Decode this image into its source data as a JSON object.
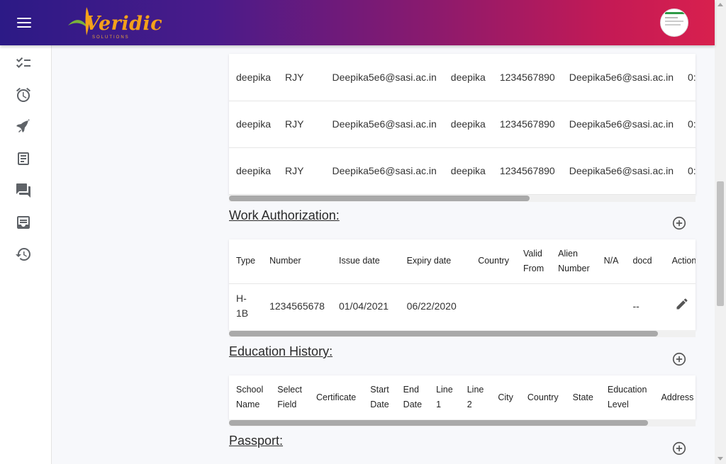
{
  "brand": {
    "logo_text": "Veridic",
    "logo_sub": "SOLUTIONS"
  },
  "colors": {
    "header_gradient_start": "#2c1a86",
    "header_gradient_end": "#d8204e",
    "logo": "#f4a11a"
  },
  "sidebar": {
    "items": [
      {
        "icon": "checklist-icon"
      },
      {
        "icon": "alarm-icon"
      },
      {
        "icon": "flight-icon"
      },
      {
        "icon": "document-icon"
      },
      {
        "icon": "chat-icon"
      },
      {
        "icon": "inbox-icon"
      },
      {
        "icon": "history-icon"
      }
    ]
  },
  "contacts_table": {
    "rows": [
      [
        "deepika",
        "RJY",
        "Deepika5e6@sasi.ac.in",
        "deepika",
        "1234567890",
        "Deepika5e6@sasi.ac.in",
        "0:"
      ],
      [
        "deepika",
        "RJY",
        "Deepika5e6@sasi.ac.in",
        "deepika",
        "1234567890",
        "Deepika5e6@sasi.ac.in",
        "0:"
      ],
      [
        "deepika",
        "RJY",
        "Deepika5e6@sasi.ac.in",
        "deepika",
        "1234567890",
        "Deepika5e6@sasi.ac.in",
        "0:"
      ]
    ]
  },
  "work_authorization": {
    "title": "Work Authorization:",
    "headers": [
      "Type",
      "Number",
      "Issue date",
      "Expiry date",
      "Country",
      "Valid From",
      "Alien Number",
      "N/A",
      "docd",
      "Actions"
    ],
    "rows": [
      {
        "type": "H-1B",
        "number": "1234565678",
        "issue_date": "01/04/2021",
        "expiry_date": "06/22/2020",
        "country": "",
        "valid_from": "",
        "alien_number": "",
        "na": "",
        "docd": "--"
      }
    ]
  },
  "education_history": {
    "title": "Education History:",
    "headers": [
      "School Name",
      "Select Field",
      "Certificate",
      "Start Date",
      "End Date",
      "Line 1",
      "Line 2",
      "City",
      "Country",
      "State",
      "Education Level",
      "Address"
    ]
  },
  "passport": {
    "title": "Passport:"
  }
}
